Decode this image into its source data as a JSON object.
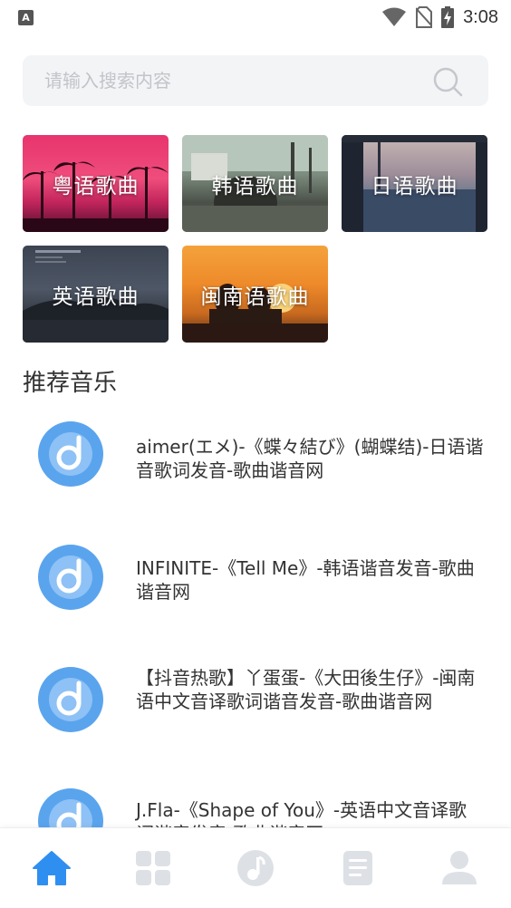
{
  "status_bar": {
    "left_icon": "A",
    "icons": [
      "wifi-icon",
      "no-sim-icon",
      "battery-charging-icon"
    ],
    "time": "3:08"
  },
  "search": {
    "placeholder": "请输入搜索内容",
    "icon": "search-icon"
  },
  "categories": [
    {
      "label": "粤语歌曲"
    },
    {
      "label": "韩语歌曲"
    },
    {
      "label": "日语歌曲"
    },
    {
      "label": "英语歌曲"
    },
    {
      "label": "闽南语歌曲"
    }
  ],
  "section_title": "推荐音乐",
  "music": [
    {
      "title": "aimer(エメ)-《蝶々結び》(蝴蝶结)-日语谐音歌词发音-歌曲谐音网"
    },
    {
      "title": "INFINITE-《Tell Me》-韩语谐音发音-歌曲谐音网"
    },
    {
      "title": "【抖音热歌】丫蛋蛋-《大田後生仔》-闽南语中文音译歌词谐音发音-歌曲谐音网"
    },
    {
      "title": "J.Fla-《Shape of You》-英语中文音译歌词谐音发音-歌曲谐音网"
    }
  ],
  "nav": [
    {
      "icon": "home-icon",
      "active": true
    },
    {
      "icon": "grid-icon",
      "active": false
    },
    {
      "icon": "music-note-icon",
      "active": false
    },
    {
      "icon": "document-icon",
      "active": false
    },
    {
      "icon": "user-icon",
      "active": false
    }
  ],
  "colors": {
    "accent": "#2f8ff0",
    "inactive": "#dde1e6",
    "music_icon_outer": "#5aa4ee",
    "music_icon_inner": "#8ec1f5"
  }
}
